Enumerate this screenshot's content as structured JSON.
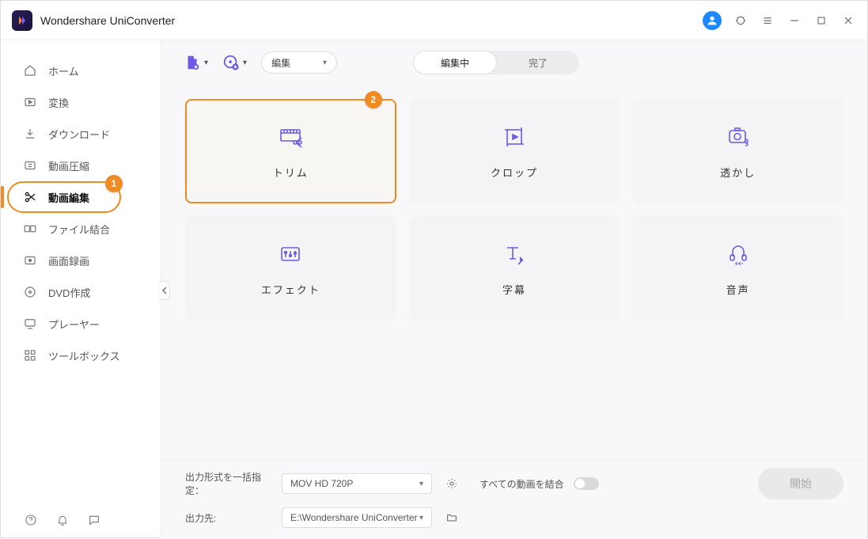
{
  "app": {
    "title": "Wondershare UniConverter"
  },
  "sidebar": {
    "items": [
      {
        "label": "ホーム"
      },
      {
        "label": "変換"
      },
      {
        "label": "ダウンロード"
      },
      {
        "label": "動画圧縮"
      },
      {
        "label": "動画編集"
      },
      {
        "label": "ファイル結合"
      },
      {
        "label": "画面録画"
      },
      {
        "label": "DVD作成"
      },
      {
        "label": "プレーヤー"
      },
      {
        "label": "ツールボックス"
      }
    ]
  },
  "annotations": {
    "badge1": "1",
    "badge2": "2"
  },
  "toolbar": {
    "edit_select": "編集",
    "seg_editing": "編集中",
    "seg_done": "完了"
  },
  "cards": {
    "trim": "トリム",
    "crop": "クロップ",
    "watermark": "透かし",
    "effect": "エフェクト",
    "subtitle": "字幕",
    "audio": "音声"
  },
  "bottom": {
    "format_label": "出力形式を一括指定：",
    "format_value": "MOV HD 720P",
    "dest_label": "出力先:",
    "dest_value": "E:\\Wondershare UniConverter",
    "merge_label": "すべての動画を結合",
    "start_label": "開始"
  }
}
